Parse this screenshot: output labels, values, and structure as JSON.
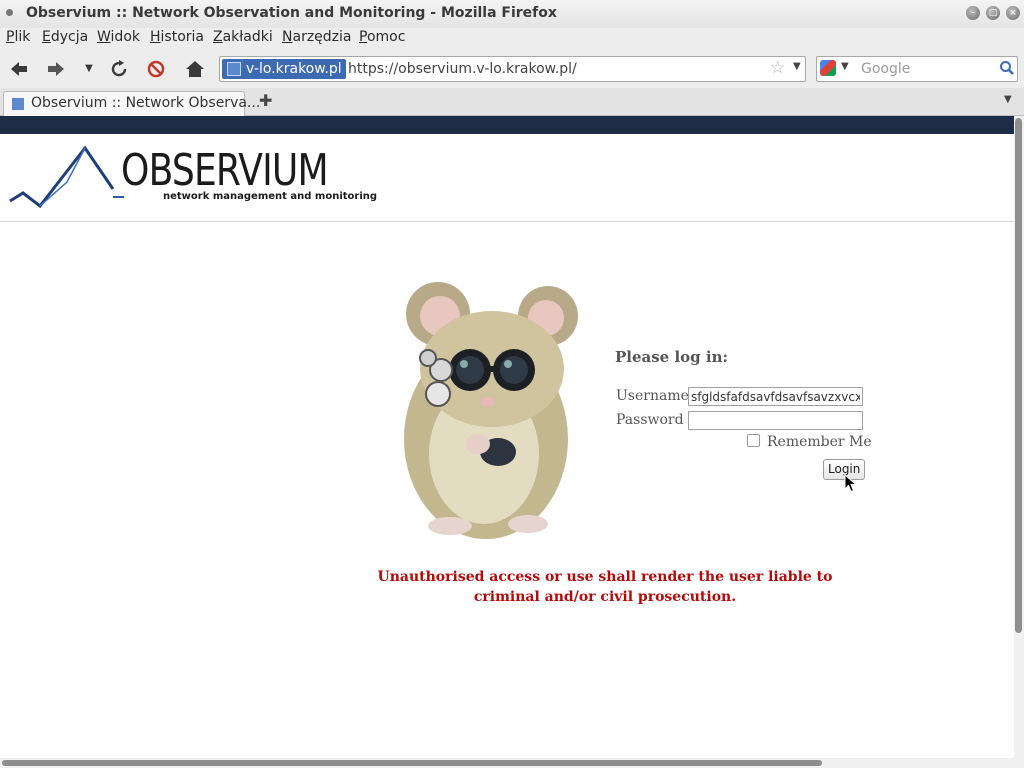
{
  "window": {
    "title": "Observium :: Network Observation and Monitoring - Mozilla Firefox",
    "controls": [
      "minimize",
      "maximize",
      "close"
    ]
  },
  "menu": {
    "items": [
      "Plik",
      "Edycja",
      "Widok",
      "Historia",
      "Zakładki",
      "Narzędzia",
      "Pomoc"
    ]
  },
  "toolbar": {
    "identity_label": "v-lo.krakow.pl",
    "url": "https://observium.v-lo.krakow.pl/",
    "search_placeholder": "Google",
    "icons": [
      "back-icon",
      "forward-icon",
      "history-dropdown-icon",
      "reload-icon",
      "stop-icon",
      "home-icon",
      "bookmark-star-icon",
      "search-go-icon"
    ]
  },
  "tabs": [
    {
      "label": "Observium :: Network Observa...",
      "active": true
    }
  ],
  "page": {
    "logo": {
      "wordmark": "OBSERVIUM",
      "tagline": "network management and monitoring"
    },
    "login": {
      "heading": "Please log in:",
      "username_label": "Username",
      "username_value": "sfgldsfafdsavfdsavfsavzxvcx",
      "password_label": "Password",
      "password_value": "",
      "remember_label": "Remember Me",
      "remember_checked": false,
      "login_button": "Login"
    },
    "warning_line1": "Unauthorised access or use shall render the user liable to",
    "warning_line2": "criminal and/or civil prosecution."
  },
  "colors": {
    "top_strip": "#1e2d45",
    "warning": "#b50a0a",
    "identity_highlight": "#3d6bb3"
  }
}
